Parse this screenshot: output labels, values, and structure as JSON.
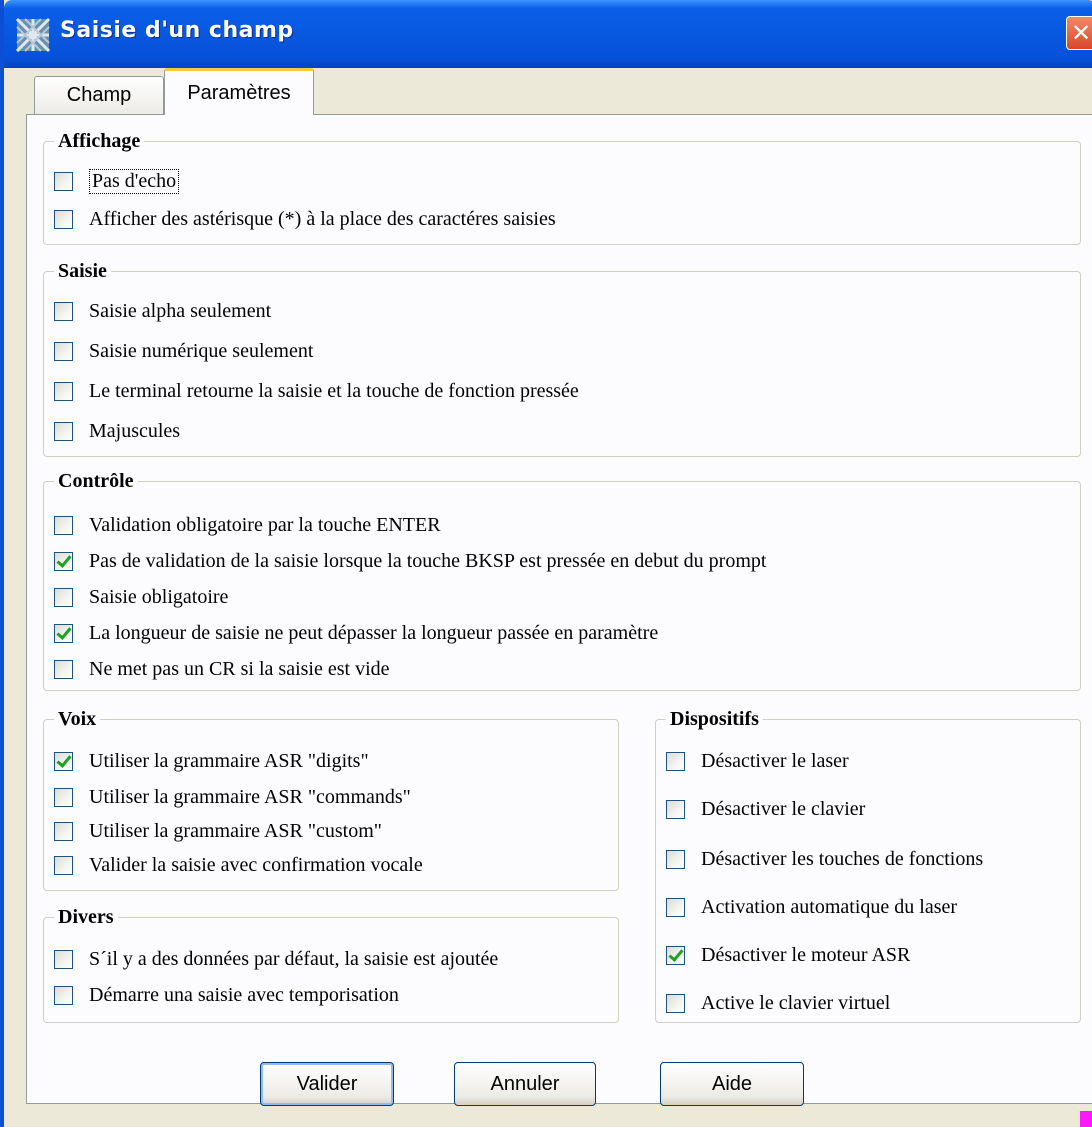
{
  "window": {
    "title": "Saisie d'un champ",
    "close_glyph": "✕"
  },
  "tabs": [
    {
      "label": "Champ"
    },
    {
      "label": "Paramètres"
    }
  ],
  "groups": {
    "affichage": {
      "title": "Affichage",
      "options": [
        {
          "label": "Pas d'echo",
          "checked": false
        },
        {
          "label": "Afficher des astérisque (*) à la place des caractéres saisies",
          "checked": false
        }
      ]
    },
    "saisie": {
      "title": "Saisie",
      "options": [
        {
          "label": "Saisie alpha seulement",
          "checked": false
        },
        {
          "label": "Saisie numérique seulement",
          "checked": false
        },
        {
          "label": "Le terminal retourne la saisie et la touche de fonction pressée",
          "checked": false
        },
        {
          "label": "Majuscules",
          "checked": false
        }
      ]
    },
    "controle": {
      "title": "Contrôle",
      "options": [
        {
          "label": "Validation obligatoire par la touche ENTER",
          "checked": false
        },
        {
          "label": "Pas de validation de la saisie lorsque la touche BKSP est pressée en debut du prompt",
          "checked": true
        },
        {
          "label": "Saisie obligatoire",
          "checked": false
        },
        {
          "label": "La longueur de saisie ne peut dépasser la longueur passée en paramètre",
          "checked": true
        },
        {
          "label": "Ne met pas un CR si la saisie est vide",
          "checked": false
        }
      ]
    },
    "voix": {
      "title": "Voix",
      "options": [
        {
          "label": "Utiliser la grammaire ASR \"digits\"",
          "checked": true
        },
        {
          "label": "Utiliser la grammaire ASR \"commands\"",
          "checked": false
        },
        {
          "label": "Utiliser la grammaire ASR \"custom\"",
          "checked": false
        },
        {
          "label": "Valider la saisie avec confirmation vocale",
          "checked": false
        }
      ]
    },
    "divers": {
      "title": "Divers",
      "options": [
        {
          "label": "S´il y a des données par défaut, la saisie est ajoutée",
          "checked": false
        },
        {
          "label": "Démarre una saisie avec temporisation",
          "checked": false
        }
      ]
    },
    "dispositifs": {
      "title": "Dispositifs",
      "options": [
        {
          "label": "Désactiver le laser",
          "checked": false
        },
        {
          "label": "Désactiver le clavier",
          "checked": false
        },
        {
          "label": "Désactiver les touches de fonctions",
          "checked": false
        },
        {
          "label": "Activation automatique du laser",
          "checked": false
        },
        {
          "label": "Désactiver le moteur ASR",
          "checked": true
        },
        {
          "label": "Active le clavier virtuel",
          "checked": false
        }
      ]
    }
  },
  "buttons": {
    "validate": "Valider",
    "cancel": "Annuler",
    "help": "Aide"
  },
  "colors": {
    "titlebar": "#0858e0",
    "dialog": "#ece9d8",
    "check": "#21a121",
    "tab_highlight": "#ffc83c"
  },
  "icons": {
    "app": "settings-pattern-icon",
    "close": "close-icon"
  }
}
